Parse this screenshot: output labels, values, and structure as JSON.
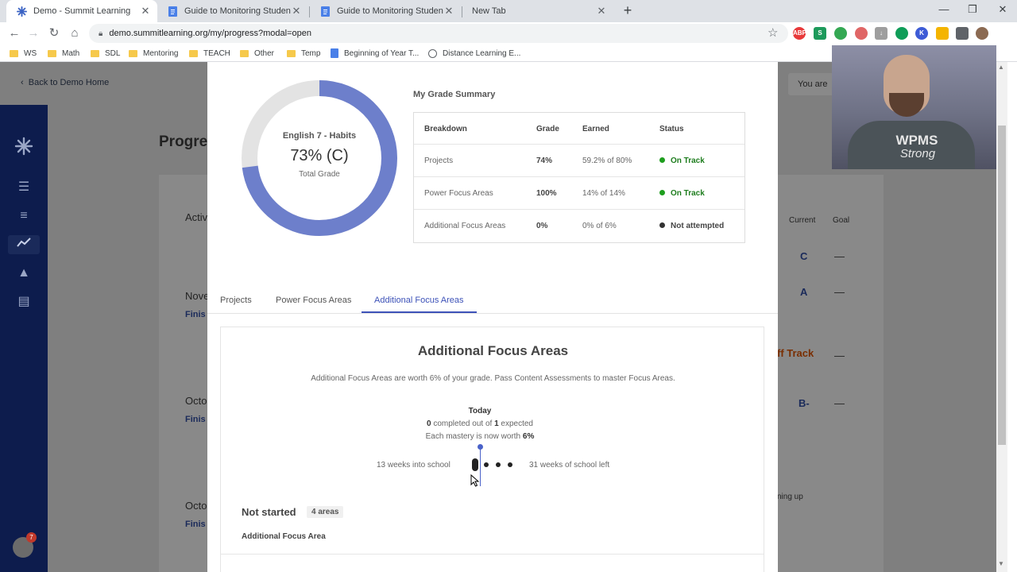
{
  "browser": {
    "tabs": [
      {
        "title": "Demo - Summit Learning",
        "icon": "summit-asterisk-icon",
        "active": true
      },
      {
        "title": "Guide to Monitoring Student Pro",
        "icon": "google-docs-icon",
        "active": false
      },
      {
        "title": "Guide to Monitoring Student Pro",
        "icon": "google-docs-icon",
        "active": false
      },
      {
        "title": "New Tab",
        "icon": "",
        "active": false
      }
    ],
    "url": "demo.summitlearning.org/my/progress?modal=open",
    "bookmarks": [
      {
        "label": "WS",
        "type": "folder"
      },
      {
        "label": "Math",
        "type": "folder"
      },
      {
        "label": "SDL",
        "type": "folder"
      },
      {
        "label": "Mentoring",
        "type": "folder"
      },
      {
        "label": "TEACH",
        "type": "folder"
      },
      {
        "label": "Other",
        "type": "folder"
      },
      {
        "label": "Temp",
        "type": "folder"
      },
      {
        "label": "Beginning of Year T...",
        "type": "doc"
      },
      {
        "label": "Distance Learning E...",
        "type": "link"
      }
    ]
  },
  "app": {
    "back_link": "Back to Demo Home",
    "you_are": "You are",
    "bg_title": "Progre",
    "bg_labels": [
      "Activ",
      "Nove",
      "Finis",
      "Octo",
      "Finis",
      "Octo",
      "Finis"
    ],
    "col_current": "Current",
    "col_goal": "Goal",
    "grades": [
      "C",
      "A",
      "B-"
    ],
    "off_track": "ff Track",
    "coming_up": "ning up",
    "dash": "—",
    "notif_count": "7"
  },
  "modal": {
    "donut": {
      "course": "English 7 - Habits",
      "percent_text": "73% (C)",
      "caption": "Total Grade",
      "value": 0.73,
      "fill_color": "#6d7fcb",
      "track_color": "#e3e3e3"
    },
    "summary": {
      "title": "My Grade Summary",
      "headers": [
        "Breakdown",
        "Grade",
        "Earned",
        "Status"
      ],
      "rows": [
        {
          "breakdown": "Projects",
          "grade": "74%",
          "earned": "59.2% of 80%",
          "status": "On Track",
          "status_color": "#1e9e1e"
        },
        {
          "breakdown": "Power Focus Areas",
          "grade": "100%",
          "earned": "14% of 14%",
          "status": "On Track",
          "status_color": "#1e9e1e"
        },
        {
          "breakdown": "Additional Focus Areas",
          "grade": "0%",
          "earned": "0% of 6%",
          "status": "Not attempted",
          "status_color": "#333333"
        }
      ]
    },
    "tabs": [
      "Projects",
      "Power Focus Areas",
      "Additional Focus Areas"
    ],
    "active_tab": "Additional Focus Areas",
    "section": {
      "title": "Additional Focus Areas",
      "description": "Additional Focus Areas are worth 6% of your grade. Pass Content Assessments to master Focus Areas.",
      "today": "Today",
      "completed": "0",
      "completed_mid": "completed out of",
      "expected": "1",
      "expected_suffix": "expected",
      "mastery_prefix": "Each mastery is now worth",
      "mastery_value": "6%",
      "weeks_into": "13 weeks into school",
      "weeks_left": "31 weeks of school left",
      "not_started": "Not started",
      "areas_badge": "4 areas",
      "sub_header": "Additional Focus Area"
    }
  },
  "webcam": {
    "shirt_line1": "WPMS",
    "shirt_line2": "Strong"
  }
}
